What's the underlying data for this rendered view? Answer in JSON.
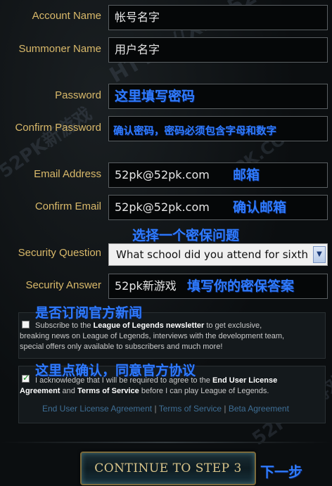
{
  "labels": {
    "account_name": "Account Name",
    "summoner_name": "Summoner Name",
    "password": "Password",
    "confirm_password": "Confirm Password",
    "email": "Email Address",
    "confirm_email": "Confirm Email",
    "security_question": "Security Question",
    "security_answer": "Security Answer"
  },
  "values": {
    "account_name": "帐号名字",
    "summoner_name": "用户名字",
    "email": "52pk@52pk.com",
    "confirm_email": "52pk@52pk.com",
    "security_question": "What school did you attend for sixth",
    "security_answer": "52pk新游戏"
  },
  "hints": {
    "password": "这里填写密码",
    "confirm_password": "确认密码，密码必须包含字母和数字",
    "email": "邮箱",
    "confirm_email": "确认邮箱",
    "security_question": "选择一个密保问题",
    "security_answer": "填写你的密保答案",
    "newsletter": "是否订阅官方新闻",
    "agree": "这里点确认，同意官方协议",
    "continue": "下一步"
  },
  "newsletter": {
    "checked": false,
    "text_1": "Subscribe to the ",
    "bold": "League of Legends newsletter",
    "text_2": " to get exclusive,",
    "line2": "breaking news on League of Legends, interviews with the development team,",
    "line3": "special offers only available to subscribers and much more!"
  },
  "agreement": {
    "checked": true,
    "text_1": "I acknowledge that I will be required to agree to the ",
    "bold_1": "End User License",
    "bold_2": "Agreement",
    "text_2": " and ",
    "bold_3": "Terms of Service",
    "text_3": " before I can play League of Legends."
  },
  "links": {
    "eula": "End User License Agreement",
    "tos": "Terms of Service",
    "beta": "Beta Agreement",
    "sep": "|"
  },
  "button": {
    "continue": "CONTINUE TO STEP 3"
  },
  "watermarks": {
    "w1": "HTTP://XIN.52PK.COM",
    "w2": "52PK新游戏",
    "w3": "52PK.COM",
    "w4": "52PK新游戏"
  },
  "colors": {
    "label": "#d9b96a",
    "hint": "#2f7bff",
    "background": "#0b0e10",
    "button_text": "#d8c48a"
  }
}
